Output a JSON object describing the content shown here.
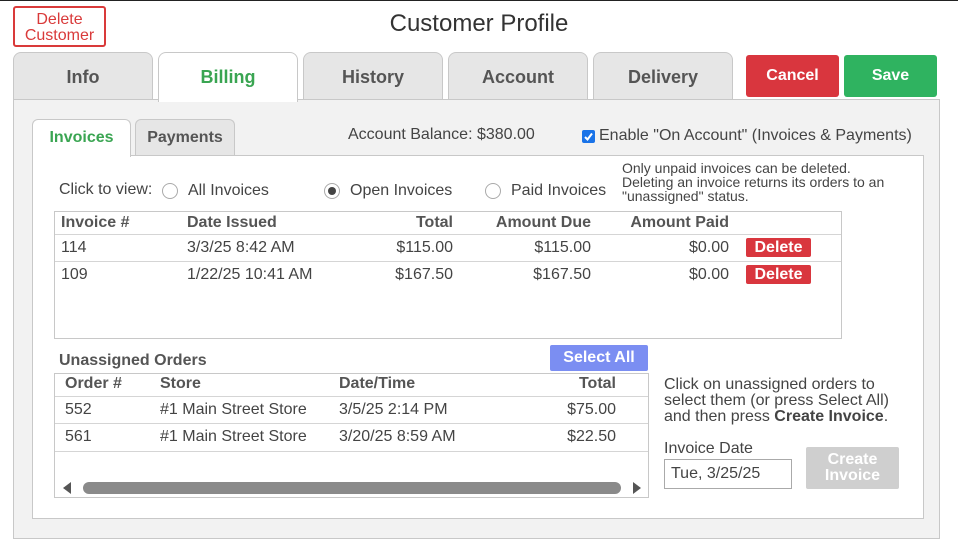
{
  "header": {
    "title": "Customer Profile",
    "delete_customer_line1": "Delete",
    "delete_customer_line2": "Customer"
  },
  "main_tabs": [
    {
      "label": "Info"
    },
    {
      "label": "Billing",
      "active": true
    },
    {
      "label": "History"
    },
    {
      "label": "Account"
    },
    {
      "label": "Delivery"
    }
  ],
  "actions": {
    "cancel_label": "Cancel",
    "save_label": "Save"
  },
  "billing": {
    "sub_tabs": [
      {
        "label": "Invoices",
        "active": true
      },
      {
        "label": "Payments"
      }
    ],
    "account_balance": "Account Balance: $380.00",
    "enable_on_account_label": "Enable \"On Account\" (Invoices & Payments)",
    "enable_on_account_checked": true,
    "note_line1": "Only unpaid invoices can be deleted.",
    "note_line2": "Deleting an invoice returns its orders to an",
    "note_line3": "\"unassigned\" status.",
    "click_to_view_label": "Click to view:",
    "view_options": [
      {
        "label": "All Invoices",
        "checked": false
      },
      {
        "label": "Open Invoices",
        "checked": true
      },
      {
        "label": "Paid Invoices",
        "checked": false
      }
    ],
    "invoice_table": {
      "headers": [
        "Invoice #",
        "Date Issued",
        "Total",
        "Amount Due",
        "Amount Paid"
      ],
      "rows": [
        {
          "invoice": "114",
          "date": "3/3/25 8:42 AM",
          "total": "$115.00",
          "due": "$115.00",
          "paid": "$0.00",
          "action": "Delete"
        },
        {
          "invoice": "109",
          "date": "1/22/25 10:41 AM",
          "total": "$167.50",
          "due": "$167.50",
          "paid": "$0.00",
          "action": "Delete"
        }
      ]
    },
    "unassigned_orders_title": "Unassigned Orders",
    "select_all_label": "Select All",
    "orders_table": {
      "headers": [
        "Order #",
        "Store",
        "Date/Time",
        "Total"
      ],
      "rows": [
        {
          "order": "552",
          "store": "#1 Main Street Store",
          "datetime": "3/5/25 2:14 PM",
          "total": "$75.00"
        },
        {
          "order": "561",
          "store": "#1 Main Street Store",
          "datetime": "3/20/25 8:59 AM",
          "total": "$22.50"
        }
      ]
    },
    "instructions_line1": "Click on unassigned orders to",
    "instructions_line2": "select them (or press Select All)",
    "instructions_line3_prefix": "and then press ",
    "instructions_line3_bold": "Create Invoice",
    "instructions_line3_suffix": ".",
    "invoice_date_label": "Invoice Date",
    "invoice_date_value": "Tue, 3/25/25",
    "create_invoice_line1": "Create",
    "create_invoice_line2": "Invoice"
  }
}
